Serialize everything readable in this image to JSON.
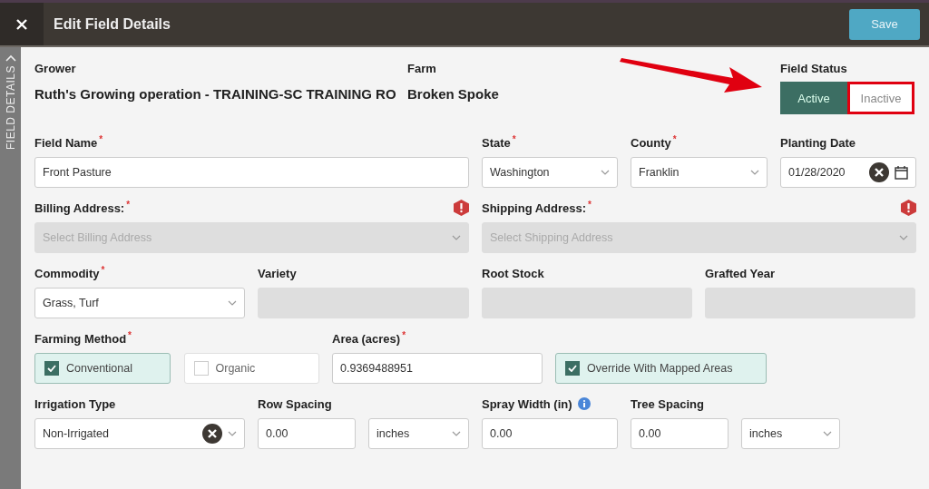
{
  "header": {
    "title": "Edit Field Details",
    "save_button": "Save"
  },
  "sidebar_tab": {
    "label": "FIELD DETAILS"
  },
  "grower": {
    "label": "Grower",
    "value": "Ruth's Growing operation - TRAINING-SC TRAINING RO"
  },
  "farm": {
    "label": "Farm",
    "value": "Broken Spoke"
  },
  "field_status": {
    "label": "Field Status",
    "options": [
      {
        "label": "Active",
        "selected": true
      },
      {
        "label": "Inactive",
        "selected": false
      }
    ]
  },
  "rows": [
    [
      {
        "kind": "text",
        "label": "Field Name",
        "required_mark": "*",
        "value": "Front Pasture"
      },
      {
        "kind": "select",
        "label": "State",
        "required_mark": "*",
        "value": "Washington"
      },
      {
        "kind": "select",
        "label": "County",
        "required_mark": "*",
        "value": "Franklin"
      },
      {
        "kind": "date",
        "label": "Planting Date",
        "value": "01/28/2020"
      }
    ],
    [
      {
        "kind": "select",
        "label": "Billing Address:",
        "required_mark": "*",
        "placeholder": "Select Billing Address",
        "disabled": true,
        "error": true
      },
      {
        "kind": "select",
        "label": "Shipping Address:",
        "required_mark": "*",
        "placeholder": "Select Shipping Address",
        "disabled": true,
        "error": true
      }
    ],
    [
      {
        "kind": "select",
        "label": "Commodity",
        "required_mark": "*",
        "value": "Grass, Turf"
      },
      {
        "kind": "text",
        "label": "Variety",
        "disabled": true
      },
      {
        "kind": "text",
        "label": "Root Stock",
        "disabled": true
      },
      {
        "kind": "text",
        "label": "Grafted Year",
        "disabled": true
      }
    ],
    [
      {
        "kind": "checks",
        "label": "Farming Method",
        "required_mark": "*",
        "options": [
          {
            "label": "Conventional",
            "checked": true
          },
          {
            "label": "Organic",
            "checked": false
          }
        ]
      },
      {
        "kind": "text",
        "label": "Area (acres)",
        "required_mark": "*",
        "value": "0.9369488951"
      },
      {
        "kind": "checks",
        "options": [
          {
            "label": "Override With Mapped Areas",
            "checked": true
          }
        ]
      }
    ],
    [
      {
        "kind": "select",
        "label": "Irrigation Type",
        "value": "Non-Irrigated",
        "clearable": true
      },
      {
        "kind": "measure",
        "label": "Row Spacing",
        "value": "0.00",
        "unit": "inches"
      },
      {
        "kind": "text",
        "label": "Spray Width (in)",
        "value": "0.00",
        "info": true
      },
      {
        "kind": "measure",
        "label": "Tree Spacing",
        "value": "0.00",
        "unit": "inches"
      }
    ]
  ]
}
